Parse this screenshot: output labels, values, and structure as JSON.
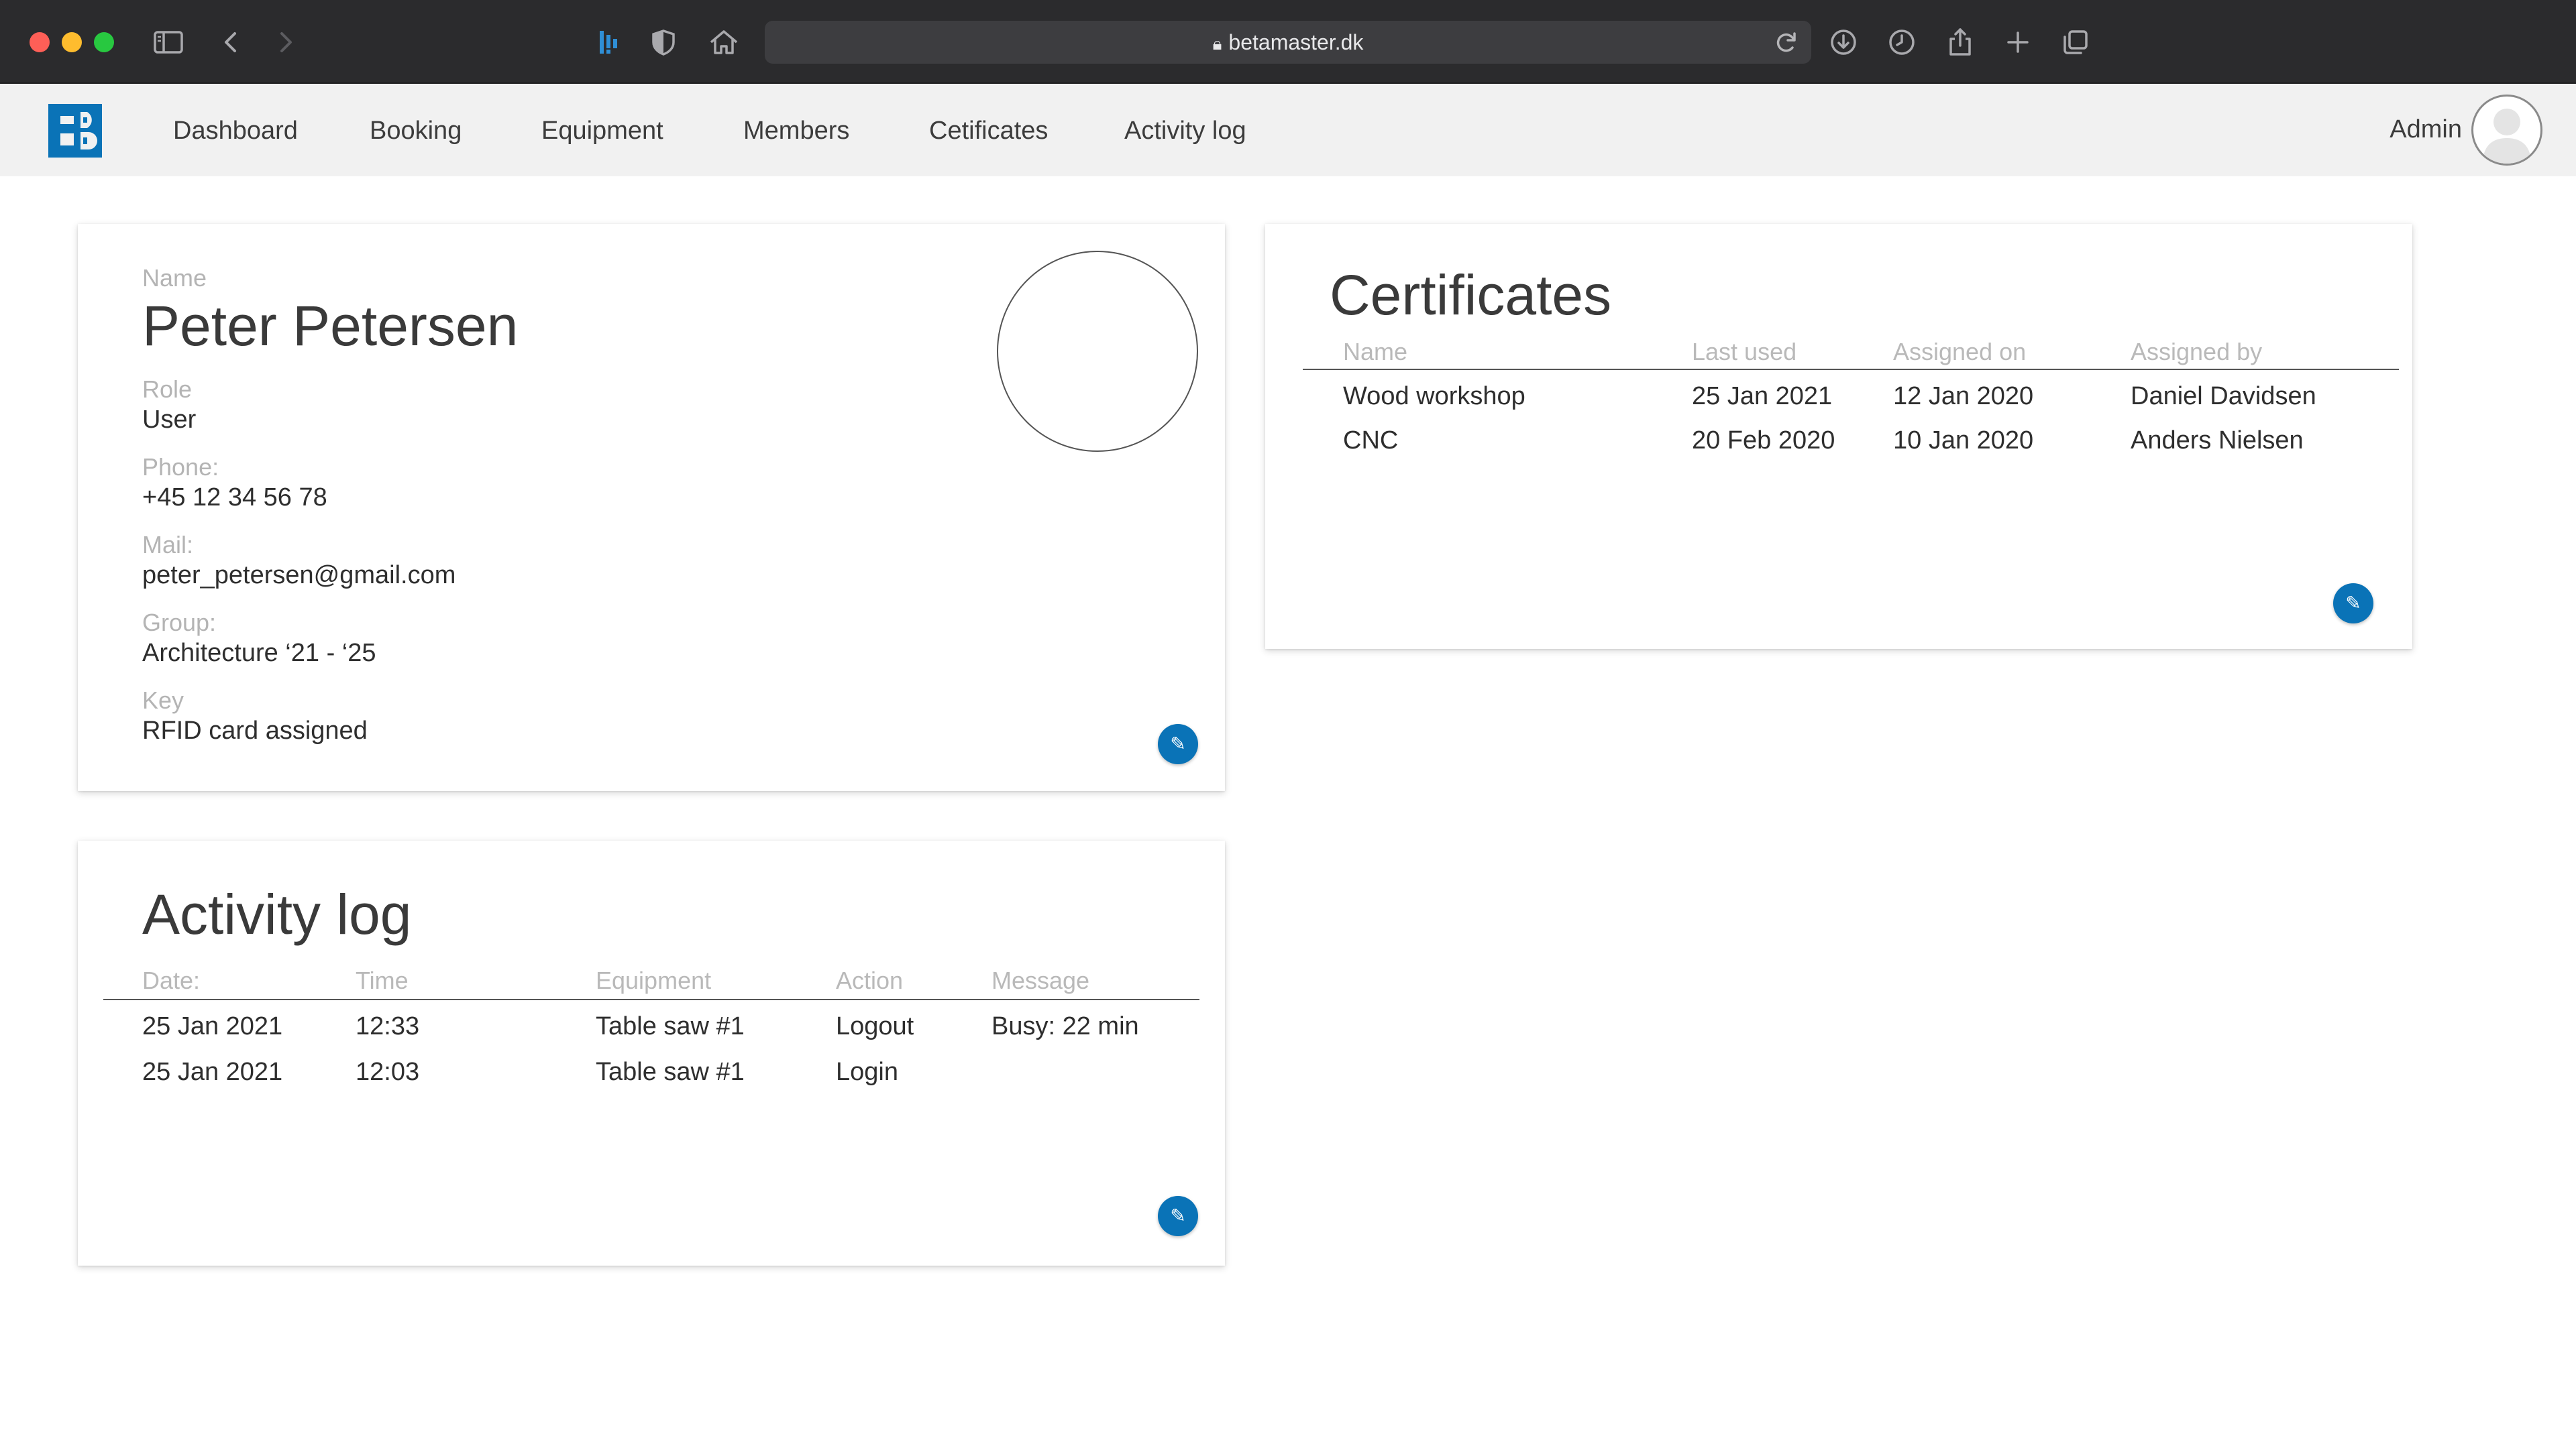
{
  "browser": {
    "url": "betamaster.dk",
    "icons": {
      "sidebar": "sidebar-toggle-icon",
      "back": "chevron-left-icon",
      "forward": "chevron-right-icon",
      "extension": "betamaster-extension-icon",
      "privacy": "shield-icon",
      "home": "home-icon",
      "lock": "lock-icon",
      "reload": "reload-icon",
      "downloads": "download-icon",
      "history": "clock-icon",
      "share": "share-icon",
      "new_tab": "plus-icon",
      "tabs": "tabs-overview-icon"
    },
    "colors": {
      "close": "#fe5f57",
      "minimize": "#febc2e",
      "zoom": "#28c840"
    }
  },
  "nav": {
    "items": [
      "Dashboard",
      "Booking",
      "Equipment",
      "Members",
      "Cetificates",
      "Activity log"
    ],
    "user_label": "Admin",
    "brand_color": "#0a73b7"
  },
  "profile": {
    "name_label": "Name",
    "name": "Peter Petersen",
    "role_label": "Role",
    "role": "User",
    "phone_label": "Phone:",
    "phone": "+45 12 34 56 78",
    "mail_label": "Mail:",
    "mail": "peter_petersen@gmail.com",
    "group_label": "Group:",
    "group": "Architecture ‘21 - ‘25",
    "key_label": "Key",
    "key": "RFID card assigned"
  },
  "certificates": {
    "title": "Certificates",
    "columns": [
      "Name",
      "Last used",
      "Assigned on",
      "Assigned by"
    ],
    "rows": [
      [
        "Wood workshop",
        "25 Jan 2021",
        "12 Jan 2020",
        "Daniel Davidsen"
      ],
      [
        "CNC",
        "20 Feb 2020",
        "10 Jan 2020",
        "Anders Nielsen"
      ]
    ]
  },
  "activity": {
    "title": "Activity log",
    "columns": [
      "Date:",
      "Time",
      "Equipment",
      "Action",
      "Message"
    ],
    "rows": [
      [
        "25 Jan 2021",
        "12:33",
        "Table saw #1",
        "Logout",
        "Busy: 22 min"
      ],
      [
        "25 Jan 2021",
        "12:03",
        "Table saw #1",
        "Login",
        ""
      ]
    ]
  },
  "edit_icon": "pencil-icon"
}
